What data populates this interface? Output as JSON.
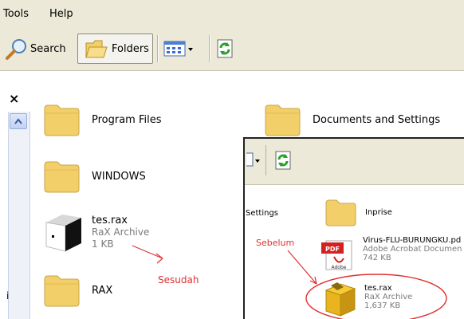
{
  "menu": {
    "tools": "Tools",
    "help": "Help"
  },
  "toolbar": {
    "search_label": "Search",
    "folders_label": "Folders"
  },
  "close_glyph": "×",
  "back": {
    "items": [
      {
        "name": "Program Files"
      },
      {
        "name": "Documents and Settings"
      },
      {
        "name": "WINDOWS"
      },
      {
        "name": "tes.rax",
        "type": "RaX Archive",
        "size": "1 KB"
      },
      {
        "name": "RAX"
      }
    ],
    "side_letter": "i"
  },
  "front": {
    "partial_label": "Settings",
    "items": [
      {
        "name": "Inprise"
      },
      {
        "name": "Virus-FLU-BURUNGKU.pd",
        "type": "Adobe Acrobat Documen",
        "size": "742 KB",
        "icon_text": "PDF",
        "icon_brand": "Adobe"
      },
      {
        "name": "tes.rax",
        "type": "RaX Archive",
        "size": "1,637 KB"
      }
    ]
  },
  "annotations": {
    "before": "Sebelum",
    "after": "Sesudah"
  },
  "colors": {
    "chrome": "#ece9d8",
    "annotation": "#e03030",
    "folder": "#f3cf6a"
  }
}
